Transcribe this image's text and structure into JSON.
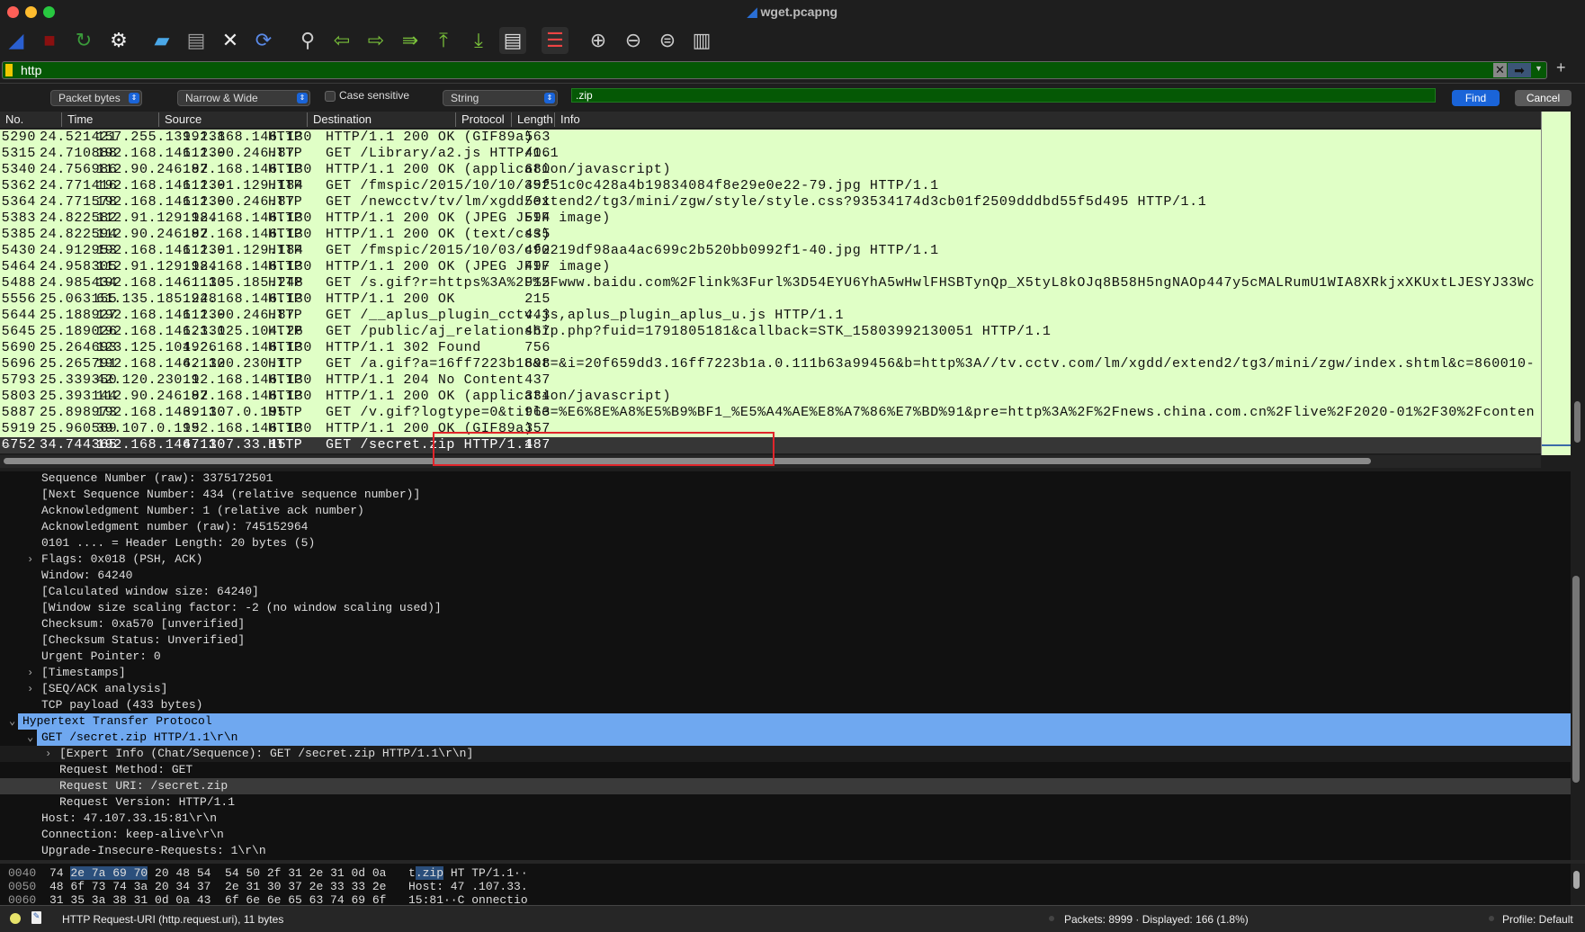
{
  "window": {
    "title": "wget.pcapng"
  },
  "toolbar": {
    "icons": [
      "shark-fin-start-icon",
      "stop-capture-icon",
      "restart-capture-icon",
      "capture-options-gear-icon",
      "open-folder-icon",
      "save-file-icon",
      "close-file-icon",
      "reload-file-icon",
      "find-packet-icon",
      "go-back-icon",
      "go-forward-icon",
      "go-to-packet-icon",
      "go-first-icon",
      "go-last-icon",
      "auto-scroll-icon",
      "colorize-icon",
      "zoom-in-icon",
      "zoom-out-icon",
      "zoom-normal-icon",
      "resize-columns-icon"
    ]
  },
  "filter": {
    "value": "http",
    "color": "#055805"
  },
  "find": {
    "search_in": "Packet bytes",
    "char_width": "Narrow & Wide",
    "case_sensitive_label": "Case sensitive",
    "case_sensitive": false,
    "type": "String",
    "value": ".zip",
    "find_label": "Find",
    "cancel_label": "Cancel"
  },
  "columns": [
    "No.",
    "Time",
    "Source",
    "Destination",
    "Protocol",
    "Length",
    "Info"
  ],
  "packets": [
    [
      "5290",
      "24.521421",
      "157.255.139.138",
      "192.168.146.130",
      "HTTP",
      "563",
      "HTTP/1.1 200 OK  (GIF89a)"
    ],
    [
      "5315",
      "24.710888",
      "192.168.146.130",
      "112.90.246.87",
      "HTTP",
      "406",
      "GET /Library/a2.js HTTP/1.1"
    ],
    [
      "5340",
      "24.756986",
      "112.90.246.87",
      "192.168.146.130",
      "HTTP",
      "680",
      "HTTP/1.1 200 OK  (application/javascript)"
    ],
    [
      "5362",
      "24.771416",
      "192.168.146.130",
      "112.91.129.184",
      "HTTP",
      "492",
      "GET /fmspic/2015/10/10/35f51c0c428a4b19834084f8e29e0e22-79.jpg HTTP/1.1"
    ],
    [
      "5364",
      "24.771578",
      "192.168.146.130",
      "112.90.246.87",
      "HTTP",
      "501",
      "GET /newcctv/tv/lm/xgdd/extend2/tg3/mini/zgw/style/style.css?93534174d3cb01f2509dddbd55f5d495 HTTP/1.1"
    ],
    [
      "5383",
      "24.822582",
      "112.91.129.184",
      "192.168.146.130",
      "HTTP",
      "594",
      "HTTP/1.1 200 OK  (JPEG JFIF image)"
    ],
    [
      "5385",
      "24.822594",
      "112.90.246.87",
      "192.168.146.130",
      "HTTP",
      "435",
      "HTTP/1.1 200 OK  (text/css)"
    ],
    [
      "5430",
      "24.912953",
      "192.168.146.130",
      "112.91.129.184",
      "HTTP",
      "492",
      "GET /fmspic/2015/10/03/cf0219df98aa4ac699c2b520bb0992f1-40.jpg HTTP/1.1"
    ],
    [
      "5464",
      "24.958305",
      "112.91.129.184",
      "192.168.146.130",
      "HTTP",
      "497",
      "HTTP/1.1 200 OK  (JPEG JFIF image)"
    ],
    [
      "5488",
      "24.985434",
      "192.168.146.130",
      "61.135.185.248",
      "HTTP",
      "915",
      "GET /s.gif?r=https%3A%2F%2Fwww.baidu.com%2Flink%3Furl%3D54EYU6YhA5wHwlFHSBTynQp_X5tyL8kOJq8B58H5ngNAOp447y5cMALRumU1WIA8XRkjxXKUxtLJESYJ33Wc"
    ],
    [
      "5556",
      "25.063155",
      "61.135.185.248",
      "192.168.146.130",
      "HTTP",
      "215",
      "HTTP/1.1 200 OK"
    ],
    [
      "5644",
      "25.188927",
      "192.168.146.130",
      "112.90.246.87",
      "HTTP",
      "443",
      "GET /__aplus_plugin_cctv.js,aplus_plugin_aplus_u.js HTTP/1.1"
    ],
    [
      "5645",
      "25.189026",
      "192.168.146.130",
      "123.125.104.26",
      "HTTP",
      "467",
      "GET /public/aj_relationship.php?fuid=1791805181&callback=STK_15803992130051 HTTP/1.1"
    ],
    [
      "5690",
      "25.264693",
      "123.125.104.26",
      "192.168.146.130",
      "HTTP",
      "756",
      "HTTP/1.1 302 Found"
    ],
    [
      "5696",
      "25.265791",
      "192.168.146.130",
      "42.120.230.1",
      "HTTP",
      "698",
      "GET /a.gif?a=16ff7223b18&t=&i=20f659dd3.16ff7223b1a.0.111b63a99456&b=http%3A//tv.cctv.com/lm/xgdd/extend2/tg3/mini/zgw/index.shtml&c=860010-"
    ],
    [
      "5793",
      "25.339350",
      "42.120.230.1",
      "192.168.146.130",
      "HTTP",
      "437",
      "HTTP/1.1 204 No Content"
    ],
    [
      "5803",
      "25.393144",
      "112.90.246.87",
      "192.168.146.130",
      "HTTP",
      "334",
      "HTTP/1.1 200 OK  (application/javascript)"
    ],
    [
      "5887",
      "25.898973",
      "192.168.146.130",
      "39.107.0.195",
      "HTTP",
      "963",
      "GET /v.gif?logtype=0&title=%E6%8E%A8%E5%B9%BF1_%E5%A4%AE%E8%A7%86%E7%BD%91&pre=http%3A%2F%2Fnews.china.com.cn%2Flive%2F2020-01%2F30%2Fconten"
    ],
    [
      "5919",
      "25.960569",
      "39.107.0.195",
      "192.168.146.130",
      "HTTP",
      "357",
      "HTTP/1.1 200 OK  (GIF89a)"
    ],
    [
      "6752",
      "34.744365",
      "192.168.146.130",
      "47.107.33.15",
      "HTTP",
      "487",
      "GET /secret.zip HTTP/1.1"
    ]
  ],
  "selected_packet": "6752",
  "details": [
    {
      "t": "Sequence Number (raw): 3375172501",
      "lvl": 1,
      "exp": ""
    },
    {
      "t": "[Next Sequence Number: 434    (relative sequence number)]",
      "lvl": 1,
      "exp": ""
    },
    {
      "t": "Acknowledgment Number: 1    (relative ack number)",
      "lvl": 1,
      "exp": ""
    },
    {
      "t": "Acknowledgment number (raw): 745152964",
      "lvl": 1,
      "exp": ""
    },
    {
      "t": "0101 .... = Header Length: 20 bytes (5)",
      "lvl": 1,
      "exp": ""
    },
    {
      "t": "Flags: 0x018 (PSH, ACK)",
      "lvl": 1,
      "exp": "collapsed"
    },
    {
      "t": "Window: 64240",
      "lvl": 1,
      "exp": ""
    },
    {
      "t": "[Calculated window size: 64240]",
      "lvl": 1,
      "exp": ""
    },
    {
      "t": "[Window size scaling factor: -2 (no window scaling used)]",
      "lvl": 1,
      "exp": ""
    },
    {
      "t": "Checksum: 0xa570 [unverified]",
      "lvl": 1,
      "exp": ""
    },
    {
      "t": "[Checksum Status: Unverified]",
      "lvl": 1,
      "exp": ""
    },
    {
      "t": "Urgent Pointer: 0",
      "lvl": 1,
      "exp": ""
    },
    {
      "t": "[Timestamps]",
      "lvl": 1,
      "exp": "collapsed"
    },
    {
      "t": "[SEQ/ACK analysis]",
      "lvl": 1,
      "exp": "collapsed"
    },
    {
      "t": "TCP payload (433 bytes)",
      "lvl": 1,
      "exp": ""
    },
    {
      "t": "Hypertext Transfer Protocol",
      "lvl": 0,
      "exp": "expanded",
      "hl": "blue"
    },
    {
      "t": "GET /secret.zip HTTP/1.1\\r\\n",
      "lvl": 1,
      "exp": "expanded",
      "hl": "blue"
    },
    {
      "t": "[Expert Info (Chat/Sequence): GET /secret.zip HTTP/1.1\\r\\n]",
      "lvl": 2,
      "exp": "collapsed",
      "hl": "dark"
    },
    {
      "t": "Request Method: GET",
      "lvl": 2,
      "exp": ""
    },
    {
      "t": "Request URI: /secret.zip",
      "lvl": 2,
      "exp": "",
      "hl": "selected"
    },
    {
      "t": "Request Version: HTTP/1.1",
      "lvl": 2,
      "exp": ""
    },
    {
      "t": "Host: 47.107.33.15:81\\r\\n",
      "lvl": 1,
      "exp": ""
    },
    {
      "t": "Connection: keep-alive\\r\\n",
      "lvl": 1,
      "exp": ""
    },
    {
      "t": "Upgrade-Insecure-Requests: 1\\r\\n",
      "lvl": 1,
      "exp": ""
    }
  ],
  "hex": [
    {
      "off": "0040",
      "pre": "74 ",
      "hl": "2e 7a 69 70",
      "post": " 20 48 54  54 50 2f 31 2e 31 0d 0a",
      "apre": "t",
      "ahl": ".zip",
      "apost": " HT TP/1.1··"
    },
    {
      "off": "0050",
      "pre": "48 6f 73 74 3a 20 34 37  2e 31 30 37 2e 33 33 2e",
      "hl": "",
      "post": "",
      "apre": "Host: 47 .107.33.",
      "ahl": "",
      "apost": ""
    },
    {
      "off": "0060",
      "pre": "31 35 3a 38 31 0d 0a 43  6f 6e 6e 65 63 74 69 6f",
      "hl": "",
      "post": "",
      "apre": "15:81··C onnectio",
      "ahl": "",
      "apost": ""
    }
  ],
  "status": {
    "field": "HTTP Request-URI (http.request.uri), 11 bytes",
    "packets": "Packets: 8999 · Displayed: 166 (1.8%)",
    "profile": "Profile: Default"
  }
}
